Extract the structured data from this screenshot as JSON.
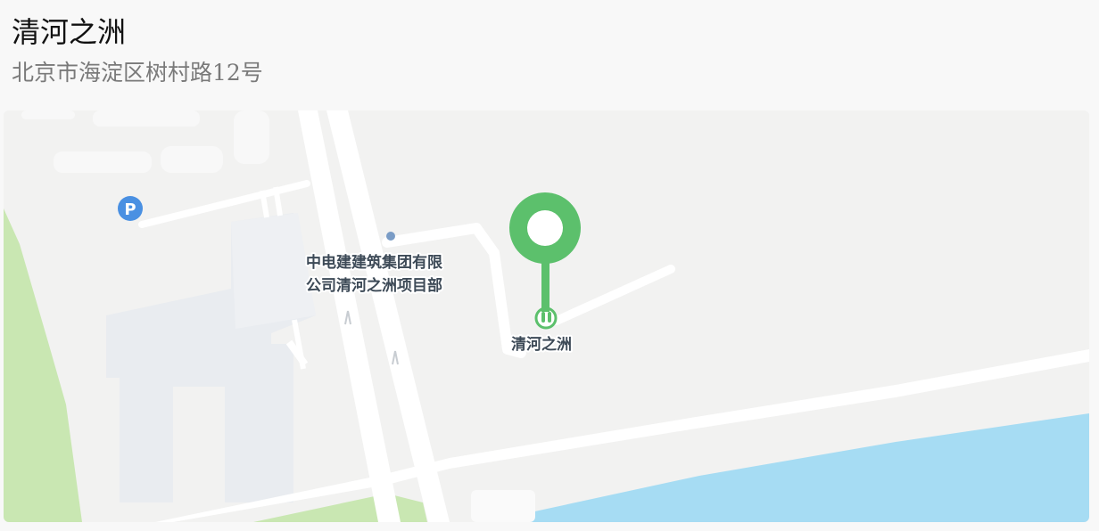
{
  "place": {
    "name": "清河之洲",
    "address": "北京市海淀区树村路12号"
  },
  "map": {
    "marker_label": "清河之洲",
    "poi_label_line1": "中电建建筑集团有限",
    "poi_label_line2": "公司清河之洲项目部",
    "parking_symbol": "P",
    "colors": {
      "marker": "#5cc06c",
      "water": "#a6dcf3",
      "park": "#c9e7b2",
      "road": "#ffffff",
      "land": "#f2f2f1",
      "building": "#e9ecf0",
      "parking": "#4a90e2"
    },
    "icons": [
      "map-pin-icon",
      "parking-icon",
      "toilet-icon",
      "bus-stop-icon"
    ]
  }
}
